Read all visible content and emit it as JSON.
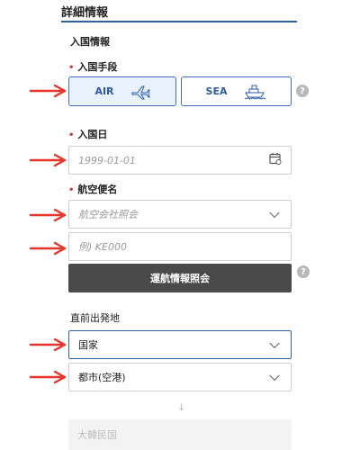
{
  "header": {
    "title": "詳細情報"
  },
  "section": {
    "title": "入国情報"
  },
  "entry_method": {
    "label": "入国手段",
    "options": [
      {
        "label": "AIR",
        "icon": "airplane-icon",
        "selected": true
      },
      {
        "label": "SEA",
        "icon": "ship-icon",
        "selected": false
      }
    ],
    "help_icon": "?"
  },
  "entry_date": {
    "label": "入国日",
    "placeholder": "1999-01-01",
    "icon": "calendar-icon"
  },
  "flight": {
    "label": "航空便名",
    "airline_placeholder": "航空会社照会",
    "flight_placeholder": "例) KE000",
    "lookup_button": "運航情報照会",
    "help_icon": "?"
  },
  "departure": {
    "label": "直前出発地",
    "country_value": "国家",
    "city_value": "都市(空港)",
    "arrow": "↓",
    "destination_value": "大韓民国"
  },
  "colors": {
    "accent": "#2f5fa8",
    "required": "#d93a3a",
    "annotation_arrow": "#e8332a",
    "dark_button": "#4a4a4a"
  }
}
